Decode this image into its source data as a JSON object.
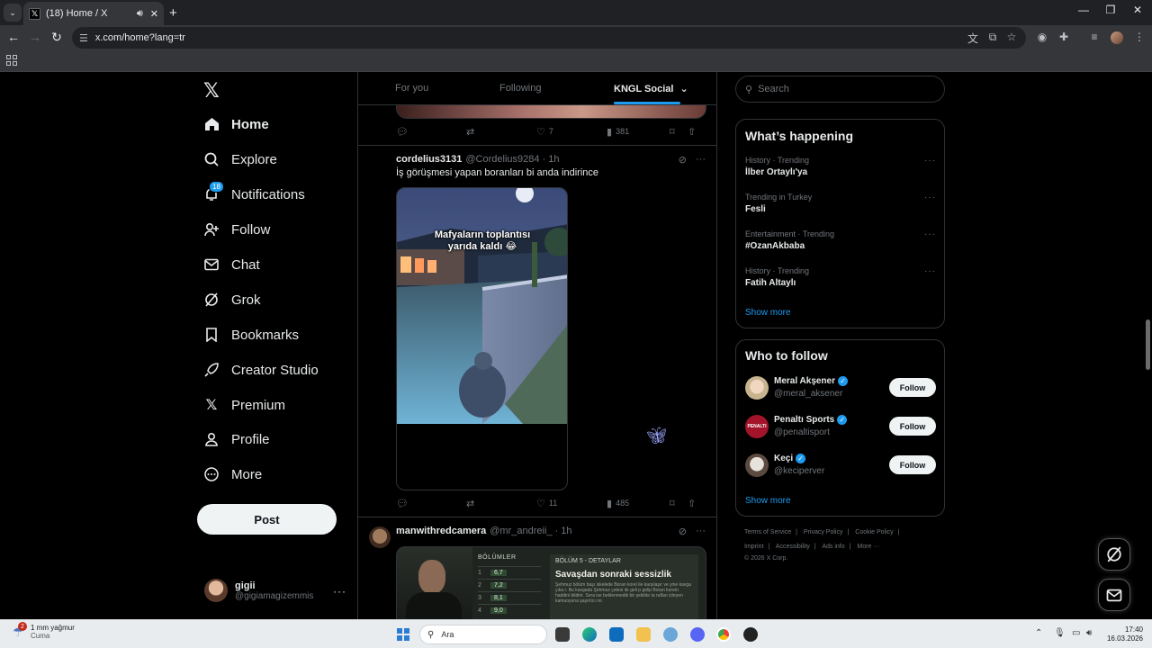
{
  "browser": {
    "tab_title": "(18) Home / X",
    "url": "x.com/home?lang=tr"
  },
  "nav": {
    "items": [
      {
        "label": "Home",
        "icon": "home-icon"
      },
      {
        "label": "Explore",
        "icon": "search-icon"
      },
      {
        "label": "Notifications",
        "icon": "bell-icon",
        "badge": "18"
      },
      {
        "label": "Follow",
        "icon": "person-add-icon"
      },
      {
        "label": "Chat",
        "icon": "mail-icon"
      },
      {
        "label": "Grok",
        "icon": "grok-icon"
      },
      {
        "label": "Bookmarks",
        "icon": "bookmark-icon"
      },
      {
        "label": "Creator Studio",
        "icon": "rocket-icon"
      },
      {
        "label": "Premium",
        "icon": "x-logo-icon"
      },
      {
        "label": "Profile",
        "icon": "person-icon"
      },
      {
        "label": "More",
        "icon": "more-circle-icon"
      }
    ],
    "post_label": "Post",
    "user_name": "gigii",
    "user_handle": "@gigiamagizemmis"
  },
  "feed": {
    "tabs": [
      "For you",
      "Following",
      "KNGL Social"
    ],
    "prev_actions": {
      "replies": "",
      "reposts": "",
      "likes": "7",
      "views": "381"
    },
    "tweet1": {
      "user": "cordelius3131",
      "handle": "@Cordelius9284",
      "time": "· 1h",
      "text": "İş görüşmesi yapan boranları bi anda indirince",
      "video_caption_line1": "Mafyaların toplantısı",
      "video_caption_line2": "yarıda kaldı 😂",
      "likes": "11",
      "views": "485"
    },
    "tweet2": {
      "user": "manwithredcamera",
      "handle": "@mr_andreii_",
      "time": "· 1h",
      "card_header": "BÖLÜMLER",
      "card_detail_header": "BÖLÜM 5 - DETAYLAR",
      "card_title": "Savaşdan sonraki sessizlik",
      "card_body": "Şehmuz bölüm başı iskelede Boran korel ile karşılaşır ve yine kavga çıka r. Bu kavgada Şehmuz çetesi ile geli p gelip Boran korein haddini bildirir. Sora ise beklenmedik bir şekilde ta rafları izleyen kamuoyuna şaşırtıcı no",
      "rows": [
        {
          "n": "1",
          "v": "6,7"
        },
        {
          "n": "2",
          "v": "7,2"
        },
        {
          "n": "3",
          "v": "8,1"
        },
        {
          "n": "4",
          "v": "9,0"
        }
      ]
    }
  },
  "sidebar": {
    "search_placeholder": "Search",
    "happening_title": "What’s happening",
    "trends": [
      {
        "category": "History · Trending",
        "title": "İlber Ortaylı'ya"
      },
      {
        "category": "Trending in Turkey",
        "title": "Fesli"
      },
      {
        "category": "Entertainment · Trending",
        "title": "#OzanAkbaba"
      },
      {
        "category": "History · Trending",
        "title": "Fatih Altaylı"
      }
    ],
    "show_more": "Show more",
    "who_title": "Who to follow",
    "who": [
      {
        "name": "Meral Akşener",
        "handle": "@meral_aksener"
      },
      {
        "name": "Penaltı Sports",
        "handle": "@penaltisport"
      },
      {
        "name": "Keçi",
        "handle": "@keciperver"
      }
    ],
    "follow_label": "Follow",
    "footer_links": [
      "Terms of Service",
      "Privacy Policy",
      "Cookie Policy",
      "Imprint",
      "Accessibility",
      "Ads info",
      "More ···"
    ],
    "copyright": "© 2026 X Corp."
  },
  "taskbar": {
    "weather_badge": "2",
    "weather_line1": "1 mm yağmur",
    "weather_line2": "Cuma",
    "search_placeholder": "Ara",
    "time": "17:40",
    "date": "16.03.2026"
  }
}
